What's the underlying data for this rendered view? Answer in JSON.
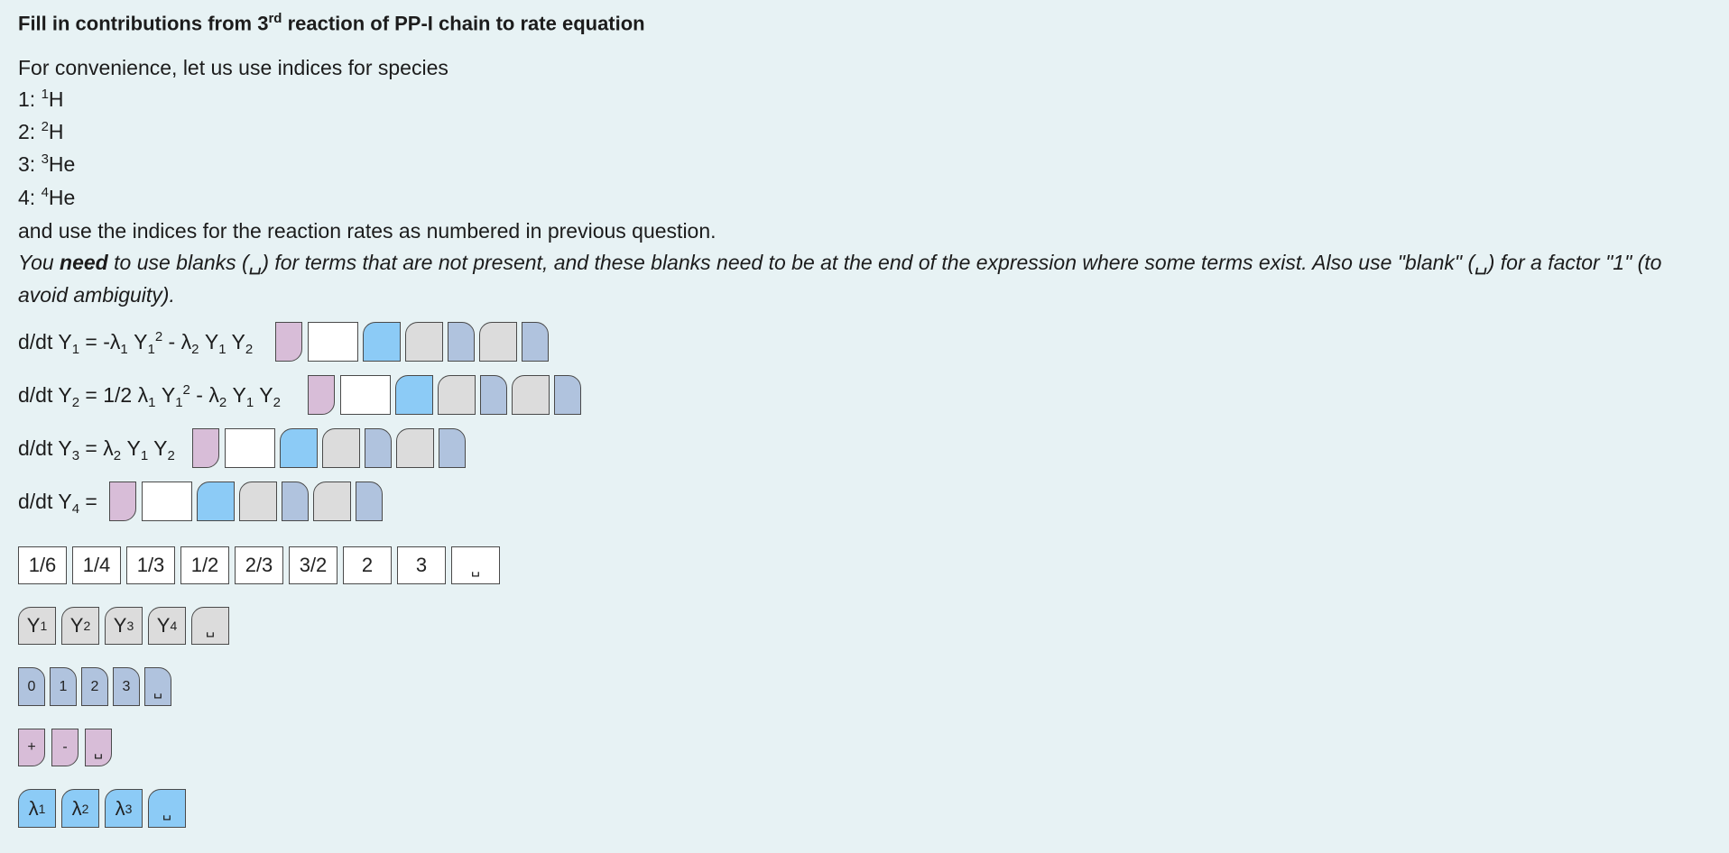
{
  "title": {
    "prefix": "Fill in contributions from 3",
    "sup": "rd",
    "suffix": " reaction of PP-I chain to rate equation"
  },
  "intro": "For convenience, let us use indices for species",
  "species": [
    {
      "index": "1: ",
      "mass": "1",
      "sym": "H"
    },
    {
      "index": "2: ",
      "mass": "2",
      "sym": "H"
    },
    {
      "index": "3: ",
      "mass": "3",
      "sym": "He"
    },
    {
      "index": "4: ",
      "mass": "4",
      "sym": "He"
    }
  ],
  "rates_note": "and use the indices for the reaction rates as numbered in previous question.",
  "instruction": {
    "part1": "You ",
    "bold": "need",
    "part2": " to use blanks (",
    "blank1": "␣",
    "part3": ") for terms that are not present, and these blanks need to be at the end of the expression where some terms exist. Also use \"blank\" (",
    "blank2": "␣",
    "part4": ") for a factor \"1\" (to",
    "line2": "avoid ambiguity)."
  },
  "equations": [
    {
      "id": "Y1",
      "text": "d/dt Y₁ = -λ₁ Y₁² - λ₂ Y₁ Y₂"
    },
    {
      "id": "Y2",
      "text": "d/dt Y₂ = 1/2 λ₁ Y₁² - λ₂ Y₁ Y₂"
    },
    {
      "id": "Y3",
      "text": "d/dt Y₃ = λ₂ Y₁ Y₂"
    },
    {
      "id": "Y4",
      "text": "d/dt Y₄ ="
    }
  ],
  "coefficient_tokens": [
    "1/6",
    "1/4",
    "1/3",
    "1/2",
    "2/3",
    "3/2",
    "2",
    "3",
    "␣"
  ],
  "species_tokens": [
    "Y₁",
    "Y₂",
    "Y₃",
    "Y₄",
    "␣"
  ],
  "exponent_tokens": [
    "0",
    "1",
    "2",
    "3",
    "␣"
  ],
  "sign_tokens": [
    "+",
    "-",
    "␣"
  ],
  "rate_tokens": [
    "λ₁",
    "λ₂",
    "λ₃",
    "␣"
  ],
  "colors": {
    "background": "#e7f2f4",
    "sign": "#d8bdd8",
    "coefficient": "#ffffff",
    "rate": "#8ccbf6",
    "species": "#dcdcdc",
    "exponent": "#b0c3de"
  }
}
